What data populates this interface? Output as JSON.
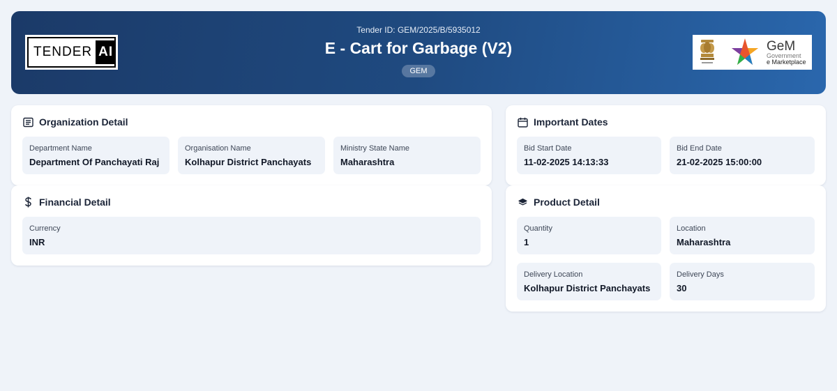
{
  "header": {
    "logo_left": {
      "word1": "TENDER",
      "word2": "AI"
    },
    "tender_id": "Tender ID: GEM/2025/B/5935012",
    "title": "E - Cart for Garbage (V2)",
    "badge": "GEM",
    "logo_right": {
      "name": "GeM",
      "line1": "Government",
      "line2": "e Marketplace"
    }
  },
  "organization": {
    "title": "Organization Detail",
    "icon": "document-list-icon",
    "fields": [
      {
        "label": "Department Name",
        "value": "Department Of Panchayati Raj"
      },
      {
        "label": "Organisation Name",
        "value": "Kolhapur District Panchayats"
      },
      {
        "label": "Ministry State Name",
        "value": "Maharashtra"
      }
    ]
  },
  "dates": {
    "title": "Important Dates",
    "icon": "calendar-icon",
    "fields": [
      {
        "label": "Bid Start Date",
        "value": "11-02-2025 14:13:33"
      },
      {
        "label": "Bid End Date",
        "value": "21-02-2025 15:00:00"
      }
    ]
  },
  "financial": {
    "title": "Financial Detail",
    "icon": "dollar-icon",
    "fields": [
      {
        "label": "Currency",
        "value": "INR"
      }
    ]
  },
  "product": {
    "title": "Product Detail",
    "icon": "layers-icon",
    "fields": [
      {
        "label": "Quantity",
        "value": "1"
      },
      {
        "label": "Location",
        "value": "Maharashtra"
      },
      {
        "label": "Delivery Location",
        "value": "Kolhapur District Panchayats"
      },
      {
        "label": "Delivery Days",
        "value": "30"
      }
    ]
  },
  "colors": {
    "header_start": "#1b3a68",
    "header_end": "#2a67ad",
    "page_bg": "#eff3f9",
    "field_bg": "#eff3f9"
  }
}
